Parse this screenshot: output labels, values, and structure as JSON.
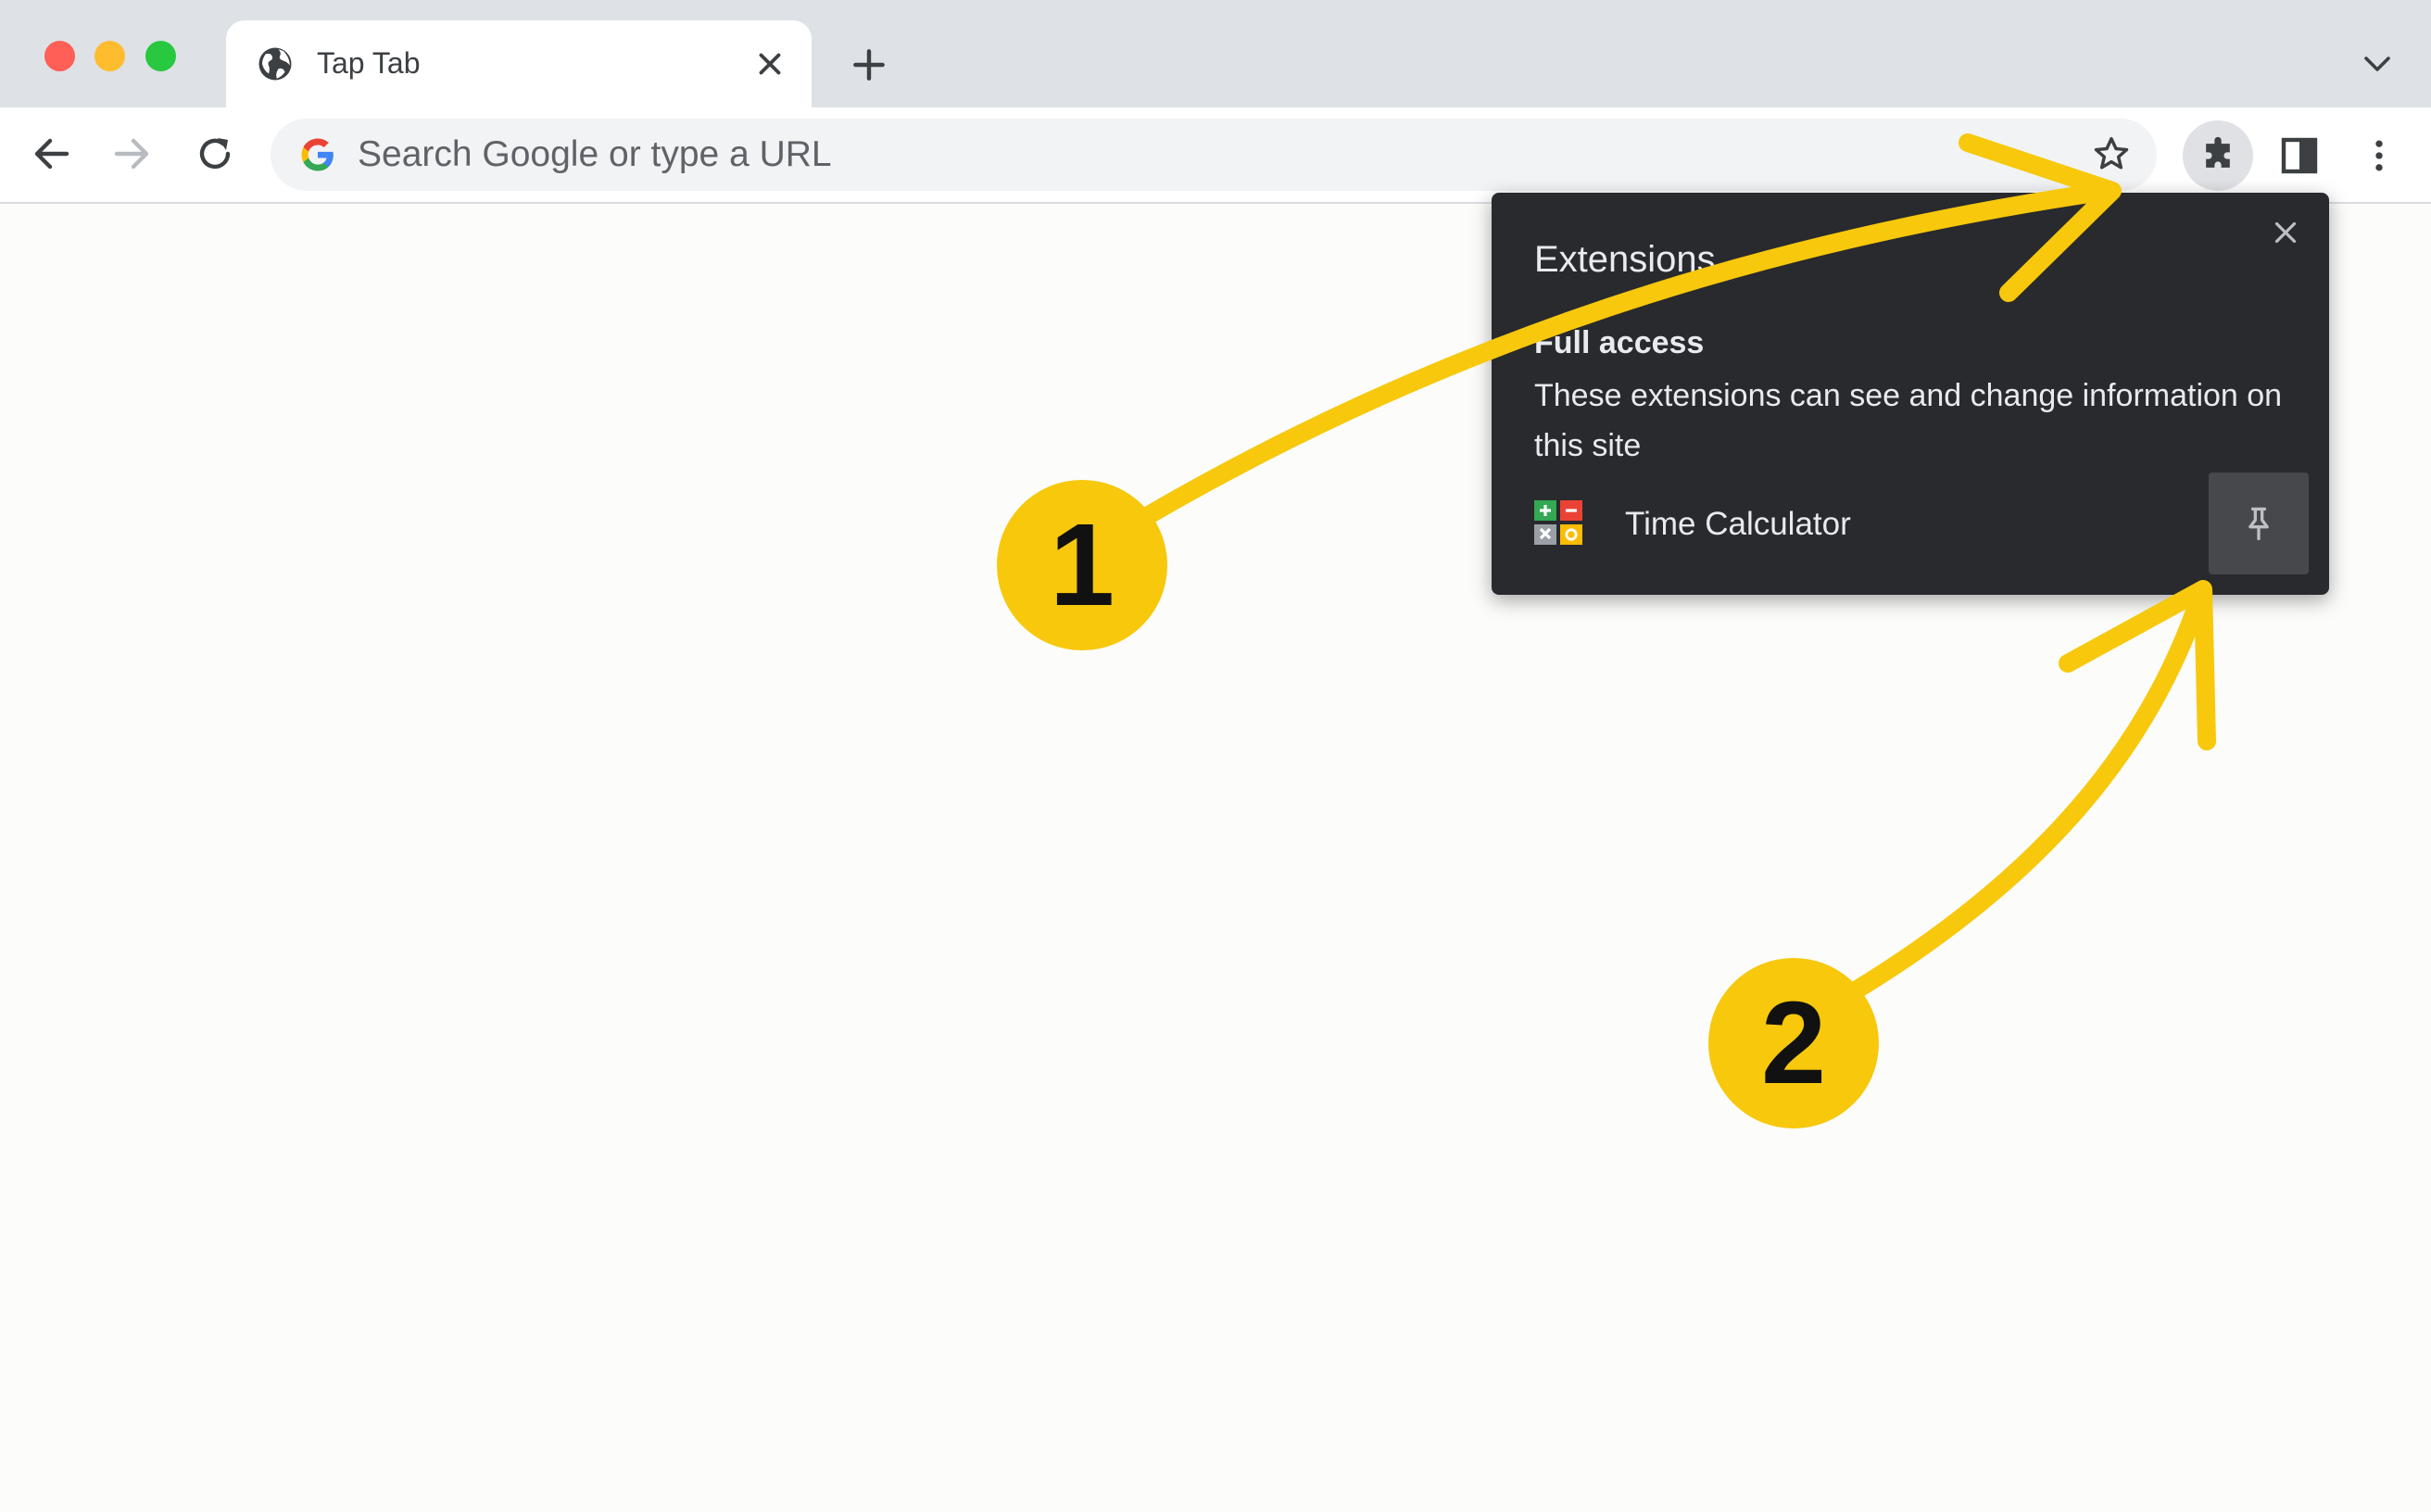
{
  "window": {
    "traffic_lights": {
      "close": "#ff5f57",
      "minimize": "#febc2e",
      "zoom": "#28c840"
    }
  },
  "tab": {
    "title": "Tap Tab",
    "icon": "globe-icon",
    "close_icon": "close-icon"
  },
  "new_tab_icon": "plus-icon",
  "tab_menu_icon": "chevron-down-icon",
  "toolbar": {
    "back_icon": "back-arrow-icon",
    "forward_icon": "forward-arrow-icon",
    "reload_icon": "reload-icon",
    "omnibox_placeholder": "Search Google or type a URL",
    "bookmark_icon": "star-icon",
    "extensions_icon": "puzzle-icon",
    "side_panel_icon": "side-panel-icon",
    "menu_icon": "kebab-menu-icon"
  },
  "extensions_popup": {
    "title": "Extensions",
    "section_heading": "Full access",
    "section_description": "These extensions can see and change information on this site",
    "items": [
      {
        "name": "Time Calculator",
        "icon": "calculator-icon",
        "pin_icon": "pin-icon"
      }
    ]
  },
  "annotations": {
    "color": "#f7c80c",
    "badges": [
      {
        "label": "1"
      },
      {
        "label": "2"
      }
    ]
  }
}
